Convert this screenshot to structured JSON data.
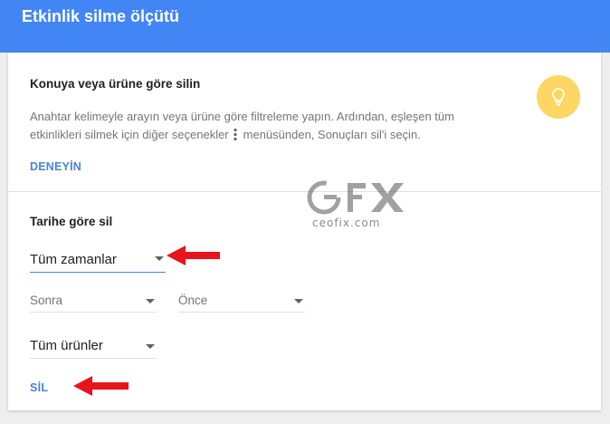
{
  "header": {
    "title": "Etkinlik silme ölçütü"
  },
  "topic_section": {
    "title": "Konuya veya ürüne göre silin",
    "desc_part1": "Anahtar kelimeyle arayın veya ürüne göre filtreleme yapın. Ardından, eşleşen tüm etkinlikleri silmek için diğer seçenekler",
    "desc_part2": "menüsünden, Sonuçları sil'i seçin.",
    "try_label": "DENEYİN",
    "icon": "lightbulb-icon"
  },
  "date_section": {
    "title": "Tarihe göre sil",
    "time_range": "Tüm zamanlar",
    "after_placeholder": "Sonra",
    "before_placeholder": "Önce",
    "products": "Tüm ürünler",
    "delete_label": "SİL"
  },
  "watermark": {
    "logo": "GFX",
    "site": "ceofix.com"
  },
  "colors": {
    "header": "#4285f4",
    "link": "#4a82d8",
    "bulb": "#fdd663",
    "arrow": "#e8141b"
  }
}
